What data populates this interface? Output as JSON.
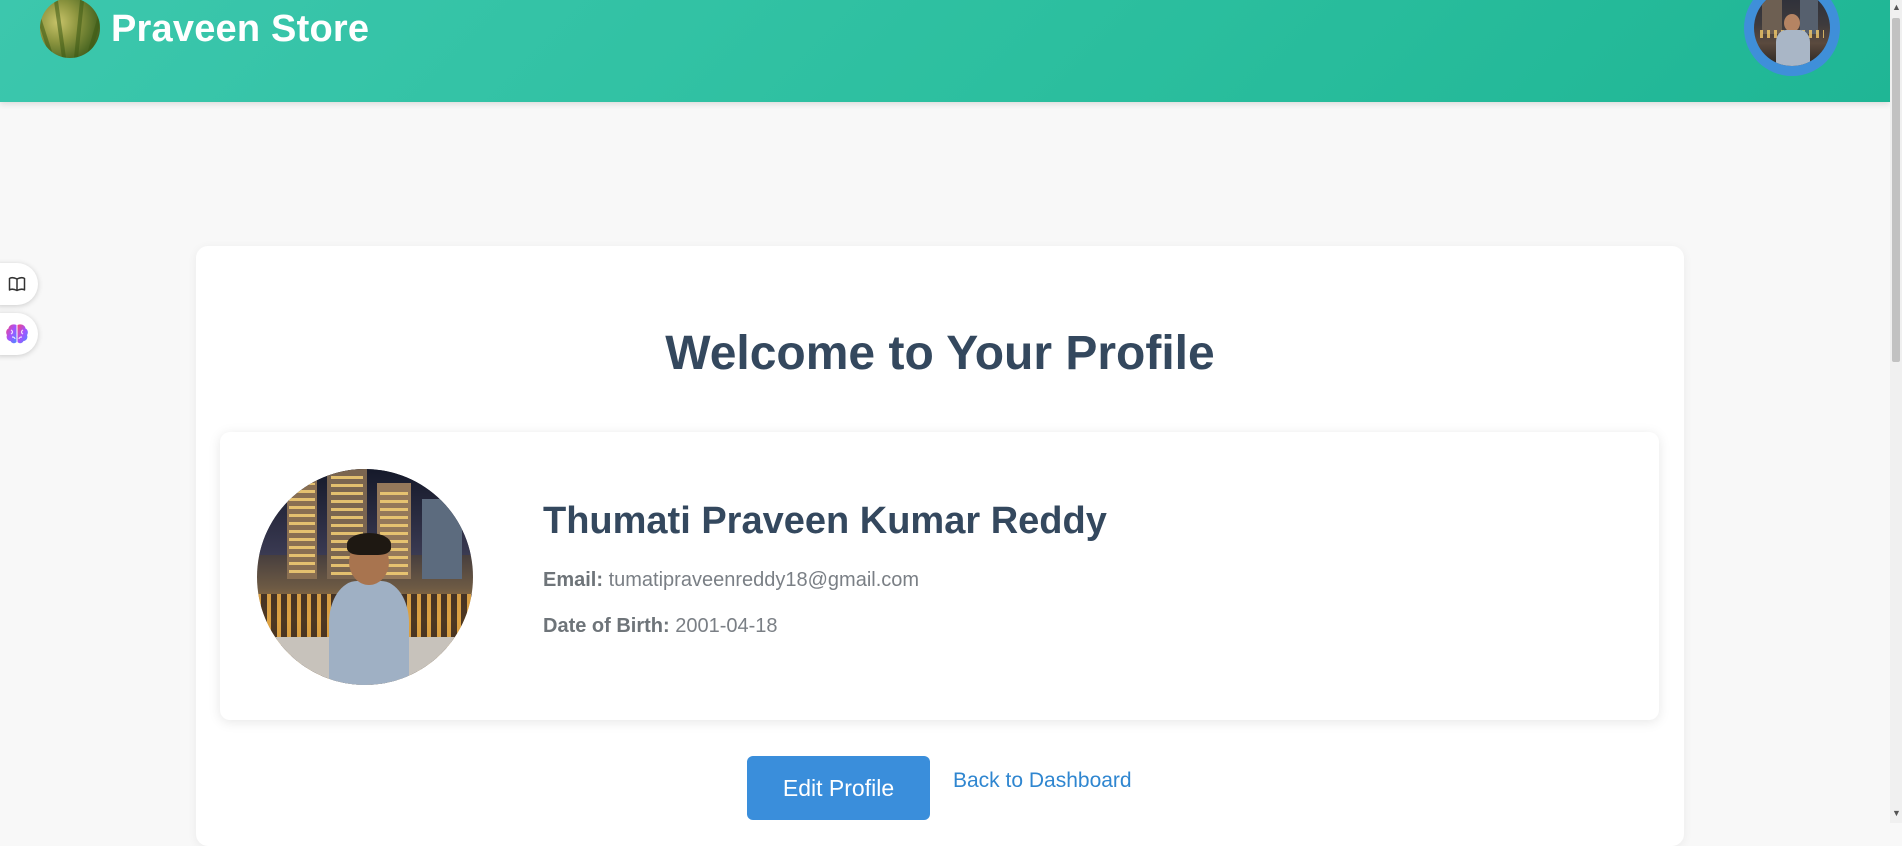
{
  "header": {
    "brand": "Praveen Store",
    "logo_icon": "rice-plant-logo",
    "avatar": "user-avatar",
    "gradient": [
      "#3cc7ad",
      "#1fb695"
    ]
  },
  "side_tools": [
    {
      "icon": "book-icon"
    },
    {
      "icon": "brain-icon"
    }
  ],
  "profile": {
    "title": "Welcome to Your Profile",
    "name": "Thumati Praveen Kumar Reddy",
    "email_label": "Email:",
    "email": "tumatipraveenreddy18@gmail.com",
    "dob_label": "Date of Birth:",
    "dob": "2001-04-18"
  },
  "actions": {
    "edit_label": "Edit Profile",
    "back_label": "Back to Dashboard"
  },
  "colors": {
    "title": "#34485e",
    "button": "#3a8edb",
    "link": "#2f86d0"
  }
}
